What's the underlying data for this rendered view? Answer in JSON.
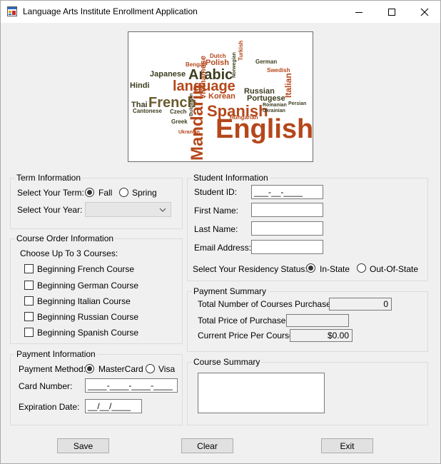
{
  "window": {
    "title": "Language Arts Institute Enrollment Application"
  },
  "banner": {
    "words": [
      {
        "text": "English",
        "color": "#b5471b"
      },
      {
        "text": "Spanish",
        "color": "#b5471b"
      },
      {
        "text": "Mandarin",
        "color": "#b5471b"
      },
      {
        "text": "French",
        "color": "#6b5a2e"
      },
      {
        "text": "Arabic",
        "color": "#3d3d1f"
      },
      {
        "text": "language",
        "color": "#b5471b"
      },
      {
        "text": "Japanese",
        "color": "#3d3d1f"
      },
      {
        "text": "Polish",
        "color": "#b5471b"
      },
      {
        "text": "Hindi",
        "color": "#3d3d1f"
      },
      {
        "text": "Korean",
        "color": "#b5471b"
      },
      {
        "text": "Thai",
        "color": "#3d3d1f"
      },
      {
        "text": "Russian",
        "color": "#3d3d1f"
      },
      {
        "text": "Portugese",
        "color": "#3d3d1f"
      },
      {
        "text": "German",
        "color": "#3d3d1f"
      },
      {
        "text": "Italian",
        "color": "#b5471b"
      },
      {
        "text": "Vietnamese",
        "color": "#b5471b"
      },
      {
        "text": "Bengali",
        "color": "#b5471b"
      },
      {
        "text": "Cantonese",
        "color": "#3d3d1f"
      },
      {
        "text": "Swedish",
        "color": "#b5471b"
      },
      {
        "text": "Czech",
        "color": "#3d3d1f"
      },
      {
        "text": "Greek",
        "color": "#3d3d1f"
      },
      {
        "text": "Hungarian",
        "color": "#b5471b"
      },
      {
        "text": "Romanian",
        "color": "#3d3d1f"
      },
      {
        "text": "Ukrainian",
        "color": "#3d3d1f"
      },
      {
        "text": "Persian",
        "color": "#3d3d1f"
      },
      {
        "text": "Turkish",
        "color": "#b5471b"
      },
      {
        "text": "Dutch",
        "color": "#b5471b"
      },
      {
        "text": "Norwegian",
        "color": "#3d3d1f"
      },
      {
        "text": "Bulgarian",
        "color": "#3d3d1f"
      },
      {
        "text": "Ukranian",
        "color": "#b5471b"
      }
    ]
  },
  "term": {
    "legend": "Term Information",
    "term_label": "Select Your Term:",
    "fall_label": "Fall",
    "spring_label": "Spring",
    "year_label": "Select Your Year:",
    "year_value": ""
  },
  "courses": {
    "legend": "Course Order Information",
    "instruction": "Choose Up To 3 Courses:",
    "items": [
      {
        "label": "Beginning French Course",
        "checked": false
      },
      {
        "label": "Beginning German Course",
        "checked": false
      },
      {
        "label": "Beginning Italian Course",
        "checked": false
      },
      {
        "label": "Beginning Russian Course",
        "checked": false
      },
      {
        "label": "Beginning Spanish Course",
        "checked": false
      }
    ]
  },
  "payment": {
    "legend": "Payment Information",
    "method_label": "Payment Method:",
    "mastercard_label": "MasterCard",
    "visa_label": "Visa",
    "card_label": "Card Number:",
    "card_mask": "____-____-____-____",
    "exp_label": "Expiration Date:",
    "exp_mask": "__/__/____"
  },
  "student": {
    "legend": "Student Information",
    "id_label": "Student ID:",
    "id_mask": "___-__-____",
    "first_label": "First Name:",
    "first_value": "",
    "last_label": "Last Name:",
    "last_value": "",
    "email_label": "Email Address:",
    "email_value": "",
    "residency_label": "Select Your Residency Status:",
    "instate_label": "In-State",
    "outstate_label": "Out-Of-State"
  },
  "summary": {
    "legend": "Payment Summary",
    "total_courses_label": "Total Number of Courses Purchased:",
    "total_courses_value": "0",
    "total_price_label": "Total Price of Purchase:",
    "total_price_value": "",
    "price_per_label": "Current Price Per Course:",
    "price_per_value": "$0.00"
  },
  "course_summary": {
    "legend": "Course Summary",
    "text": ""
  },
  "buttons": {
    "save": "Save",
    "clear": "Clear",
    "exit": "Exit"
  }
}
